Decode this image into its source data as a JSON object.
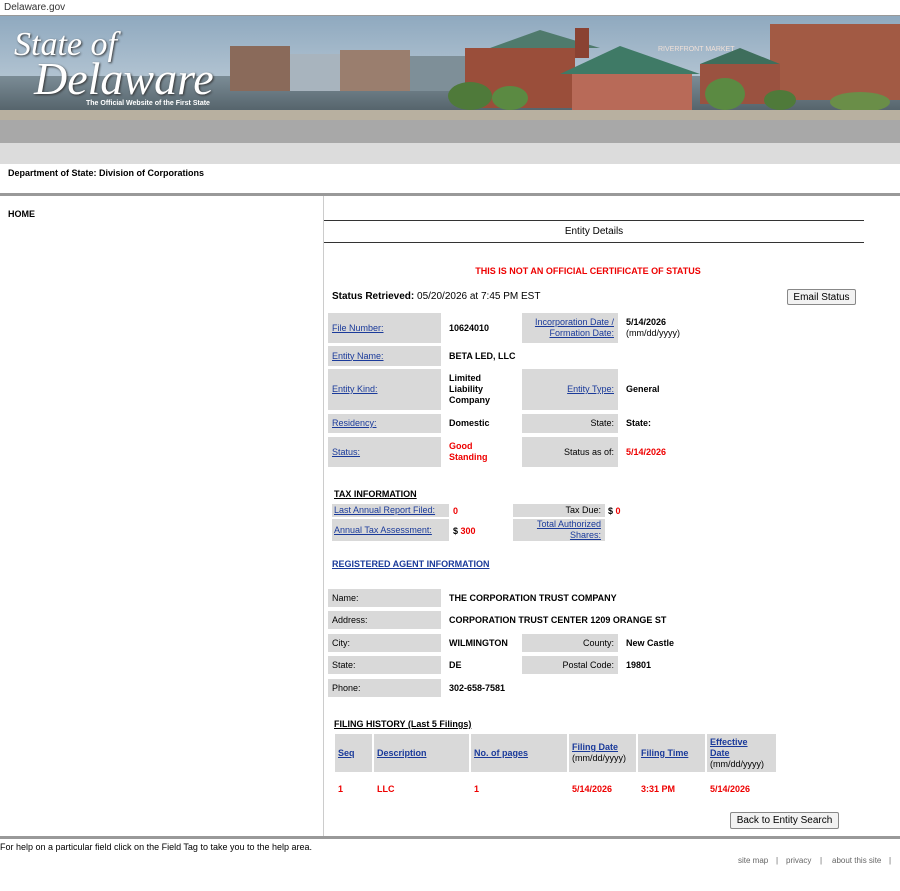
{
  "top_bar": {
    "site": "Delaware.gov"
  },
  "banner": {
    "logo_line1": "State of",
    "logo_line2": "Delaware",
    "logo_tagline": "The Official Website of the First State",
    "sign": "RIVERFRONT MARKET"
  },
  "department": "Department of State: Division of Corporations",
  "nav": {
    "home": "HOME"
  },
  "entity_details": {
    "title": "Entity Details",
    "notice": "THIS IS NOT AN OFFICIAL CERTIFICATE OF STATUS",
    "status_retrieved_label": "Status Retrieved:",
    "status_retrieved_value": "05/20/2026 at 7:45 PM EST",
    "email_button": "Email Status",
    "file_number_label": "File Number:",
    "file_number": "10624010",
    "incorporation_label_1": "Incorporation Date /",
    "incorporation_label_2": "Formation Date:",
    "incorporation_date": "5/14/2026",
    "incorporation_format": "(mm/dd/yyyy)",
    "entity_name_label": "Entity Name:",
    "entity_name": "BETA LED, LLC",
    "entity_kind_label": "Entity Kind:",
    "entity_kind": "Limited Liability Company",
    "entity_type_label": "Entity Type:",
    "entity_type": "General",
    "residency_label": "Residency:",
    "residency": "Domestic",
    "state_label": "State:",
    "state_value": "State:",
    "status_label": "Status:",
    "status": "Good Standing",
    "status_as_of_label": "Status as of:",
    "status_as_of": "5/14/2026"
  },
  "tax": {
    "heading": "TAX INFORMATION",
    "last_report_label": "Last Annual Report Filed:",
    "last_report": "0",
    "tax_due_label": "Tax Due:",
    "tax_due_currency": "$",
    "tax_due": "0",
    "annual_assessment_label": "Annual Tax Assessment:",
    "annual_assessment_currency": "$",
    "annual_assessment": "300",
    "total_shares_label_1": "Total Authorized",
    "total_shares_label_2": "Shares:"
  },
  "agent": {
    "heading": "REGISTERED AGENT INFORMATION",
    "name_label": "Name:",
    "name": "THE CORPORATION TRUST COMPANY",
    "address_label": "Address:",
    "address": "CORPORATION TRUST CENTER 1209 ORANGE ST",
    "city_label": "City:",
    "city": "WILMINGTON",
    "county_label": "County:",
    "county": "New Castle",
    "state_label": "State:",
    "state": "DE",
    "postal_label": "Postal Code:",
    "postal": "19801",
    "phone_label": "Phone:",
    "phone": "302-658-7581"
  },
  "filing_history": {
    "heading": "FILING HISTORY (Last 5 Filings)",
    "columns": {
      "seq": "Seq",
      "description": "Description",
      "pages": "No. of pages",
      "filing_date": "Filing Date",
      "filing_date_format": "(mm/dd/yyyy)",
      "filing_time": "Filing Time",
      "effective_date_1": "Effective",
      "effective_date_2": "Date",
      "effective_date_format": "(mm/dd/yyyy)"
    },
    "rows": [
      {
        "seq": "1",
        "description": "LLC",
        "pages": "1",
        "filing_date": "5/14/2026",
        "filing_time": "3:31 PM",
        "effective_date": "5/14/2026"
      }
    ]
  },
  "back_button": "Back to Entity Search",
  "help_text": "For help on a particular field click on the Field Tag to take you to the help area.",
  "footer": {
    "site_map": "site map",
    "privacy": "privacy",
    "about": "about this site",
    "sep": "|"
  },
  "colors": {
    "link": "#1a3a9a",
    "alert": "#e00000",
    "label_bg": "#d9d9d9"
  }
}
